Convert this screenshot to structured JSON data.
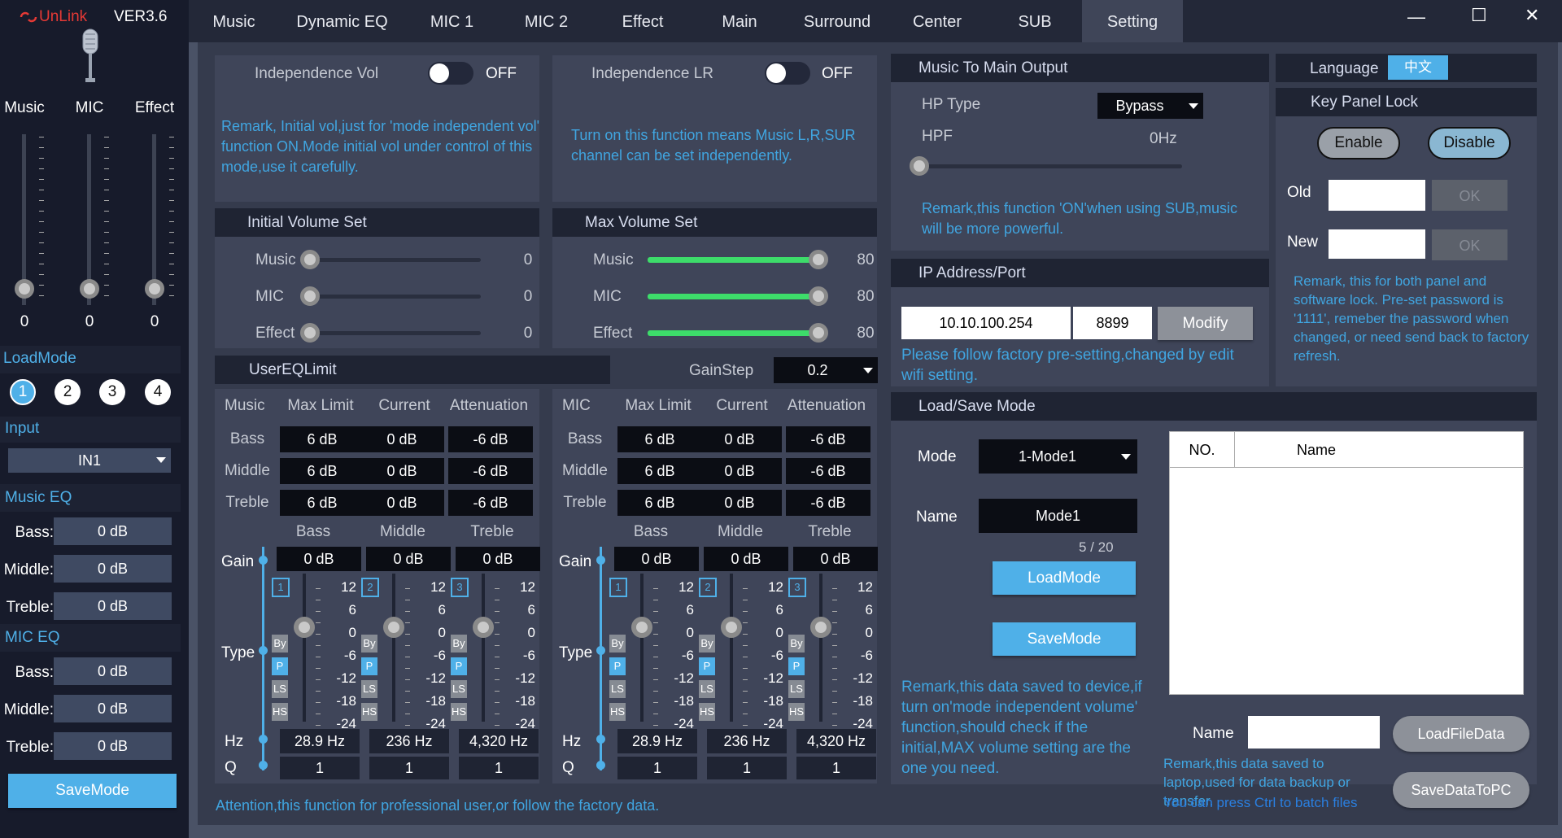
{
  "app": {
    "brand": "UnLink",
    "version": "VER3.6"
  },
  "left": {
    "channels": [
      {
        "label": "Music",
        "value": "0"
      },
      {
        "label": "MIC",
        "value": "0"
      },
      {
        "label": "Effect",
        "value": "0"
      }
    ],
    "load_mode_title": "LoadMode",
    "modes": [
      "1",
      "2",
      "3",
      "4"
    ],
    "input_title": "Input",
    "input_value": "IN1",
    "music_eq_title": "Music EQ",
    "music_eq": [
      {
        "label": "Bass:",
        "value": "0 dB"
      },
      {
        "label": "Middle:",
        "value": "0 dB"
      },
      {
        "label": "Treble:",
        "value": "0 dB"
      }
    ],
    "mic_eq_title": "MIC EQ",
    "mic_eq": [
      {
        "label": "Bass:",
        "value": "0 dB"
      },
      {
        "label": "Middle:",
        "value": "0 dB"
      },
      {
        "label": "Treble:",
        "value": "0 dB"
      }
    ],
    "save_label": "SaveMode"
  },
  "tabs": [
    "Music",
    "Dynamic EQ",
    "MIC 1",
    "MIC 2",
    "Effect",
    "Main",
    "Surround",
    "Center",
    "SUB",
    "Setting"
  ],
  "window": {
    "min": "—",
    "max": "☐",
    "close": "✕"
  },
  "indep_vol": {
    "label": "Independence Vol",
    "state": "OFF",
    "remark": "Remark, Initial vol,just for 'mode independent vol' function ON.Mode initial vol under control of this mode,use it carefully."
  },
  "indep_lr": {
    "label": "Independence LR",
    "state": "OFF",
    "remark": "Turn on this function means Music L,R,SUR channel can be set independently."
  },
  "initial_volume": {
    "title": "Initial Volume Set",
    "rows": [
      {
        "label": "Music",
        "value": "0",
        "level": 0
      },
      {
        "label": "MIC",
        "value": "0",
        "level": 0
      },
      {
        "label": "Effect",
        "value": "0",
        "level": 0
      }
    ]
  },
  "max_volume": {
    "title": "Max Volume Set",
    "rows": [
      {
        "label": "Music",
        "value": "80",
        "level": 1
      },
      {
        "label": "MIC",
        "value": "80",
        "level": 1
      },
      {
        "label": "Effect",
        "value": "80",
        "level": 1
      }
    ]
  },
  "user_eq": {
    "title": "UserEQLimit",
    "gainstep_label": "GainStep",
    "gainstep_value": "0.2",
    "attention": "Attention,this function for professional user,or follow the factory data.",
    "groups": [
      {
        "name": "Music",
        "headers": [
          "Max Limit",
          "Current",
          "Attenuation"
        ],
        "rows": [
          {
            "label": "Bass",
            "vals": [
              "6 dB",
              "0 dB",
              "-6 dB"
            ]
          },
          {
            "label": "Middle",
            "vals": [
              "6 dB",
              "0 dB",
              "-6 dB"
            ]
          },
          {
            "label": "Treble",
            "vals": [
              "6 dB",
              "0 dB",
              "-6 dB"
            ]
          }
        ],
        "bands": [
          {
            "name": "Bass",
            "gain": "0 dB",
            "num": "1",
            "hz": "28.9 Hz",
            "q": "1"
          },
          {
            "name": "Middle",
            "gain": "0 dB",
            "num": "2",
            "hz": "236 Hz",
            "q": "1"
          },
          {
            "name": "Treble",
            "gain": "0 dB",
            "num": "3",
            "hz": "4,320 Hz",
            "q": "1"
          }
        ]
      },
      {
        "name": "MIC",
        "headers": [
          "Max Limit",
          "Current",
          "Attenuation"
        ],
        "rows": [
          {
            "label": "Bass",
            "vals": [
              "6 dB",
              "0 dB",
              "-6 dB"
            ]
          },
          {
            "label": "Middle",
            "vals": [
              "6 dB",
              "0 dB",
              "-6 dB"
            ]
          },
          {
            "label": "Treble",
            "vals": [
              "6 dB",
              "0 dB",
              "-6 dB"
            ]
          }
        ],
        "bands": [
          {
            "name": "Bass",
            "gain": "0 dB",
            "num": "1",
            "hz": "28.9 Hz",
            "q": "1"
          },
          {
            "name": "Middle",
            "gain": "0 dB",
            "num": "2",
            "hz": "236 Hz",
            "q": "1"
          },
          {
            "name": "Treble",
            "gain": "0 dB",
            "num": "3",
            "hz": "4,320 Hz",
            "q": "1"
          }
        ]
      }
    ],
    "side_labels": {
      "gain": "Gain",
      "type": "Type",
      "hz": "Hz",
      "q": "Q"
    },
    "types": [
      "By",
      "P",
      "LS",
      "HS"
    ],
    "scale": [
      "12",
      "6",
      "0",
      "-6",
      "-12",
      "-18",
      "-24"
    ]
  },
  "music_main": {
    "title": "Music To Main Output",
    "hp_type_label": "HP Type",
    "hp_type_value": "Bypass",
    "hpf_label": "HPF",
    "hpf_value": "0Hz",
    "remark": "Remark,this function 'ON'when using SUB,music will be more powerful."
  },
  "ip": {
    "title": "IP Address/Port",
    "address": "10.10.100.254",
    "port": "8899",
    "modify": "Modify",
    "remark": "Please follow factory pre-setting,changed by edit wifi setting."
  },
  "language": {
    "label": "Language",
    "value": "中文"
  },
  "key_lock": {
    "title": "Key Panel Lock",
    "enable": "Enable",
    "disable": "Disable",
    "old": "Old",
    "new": "New",
    "ok": "OK",
    "remark": "Remark, this for both panel and software lock. Pre-set password is '1111', remeber the password when changed, or need send back to factory refresh."
  },
  "load_save": {
    "title": "Load/Save Mode",
    "mode_label": "Mode",
    "mode_value": "1-Mode1",
    "name_label": "Name",
    "name_value": "Mode1",
    "count": "5 / 20",
    "load": "LoadMode",
    "save": "SaveMode",
    "remark": "Remark,this data saved to device,if turn on'mode independent volume' function,should check if the initial,MAX volume setting are the one you need."
  },
  "file": {
    "col_no": "NO.",
    "col_name": "Name",
    "name_label": "Name",
    "load": "LoadFileData",
    "save": "SaveDataToPC",
    "remark": "Remark,this data saved to laptop,used for data backup or transfer.",
    "hint": "You can press Ctrl to batch files"
  },
  "colors": {
    "accent": "#4fb0e8",
    "remark": "#40a5e0",
    "green": "#3ddc6a",
    "brand": "#e53935"
  }
}
